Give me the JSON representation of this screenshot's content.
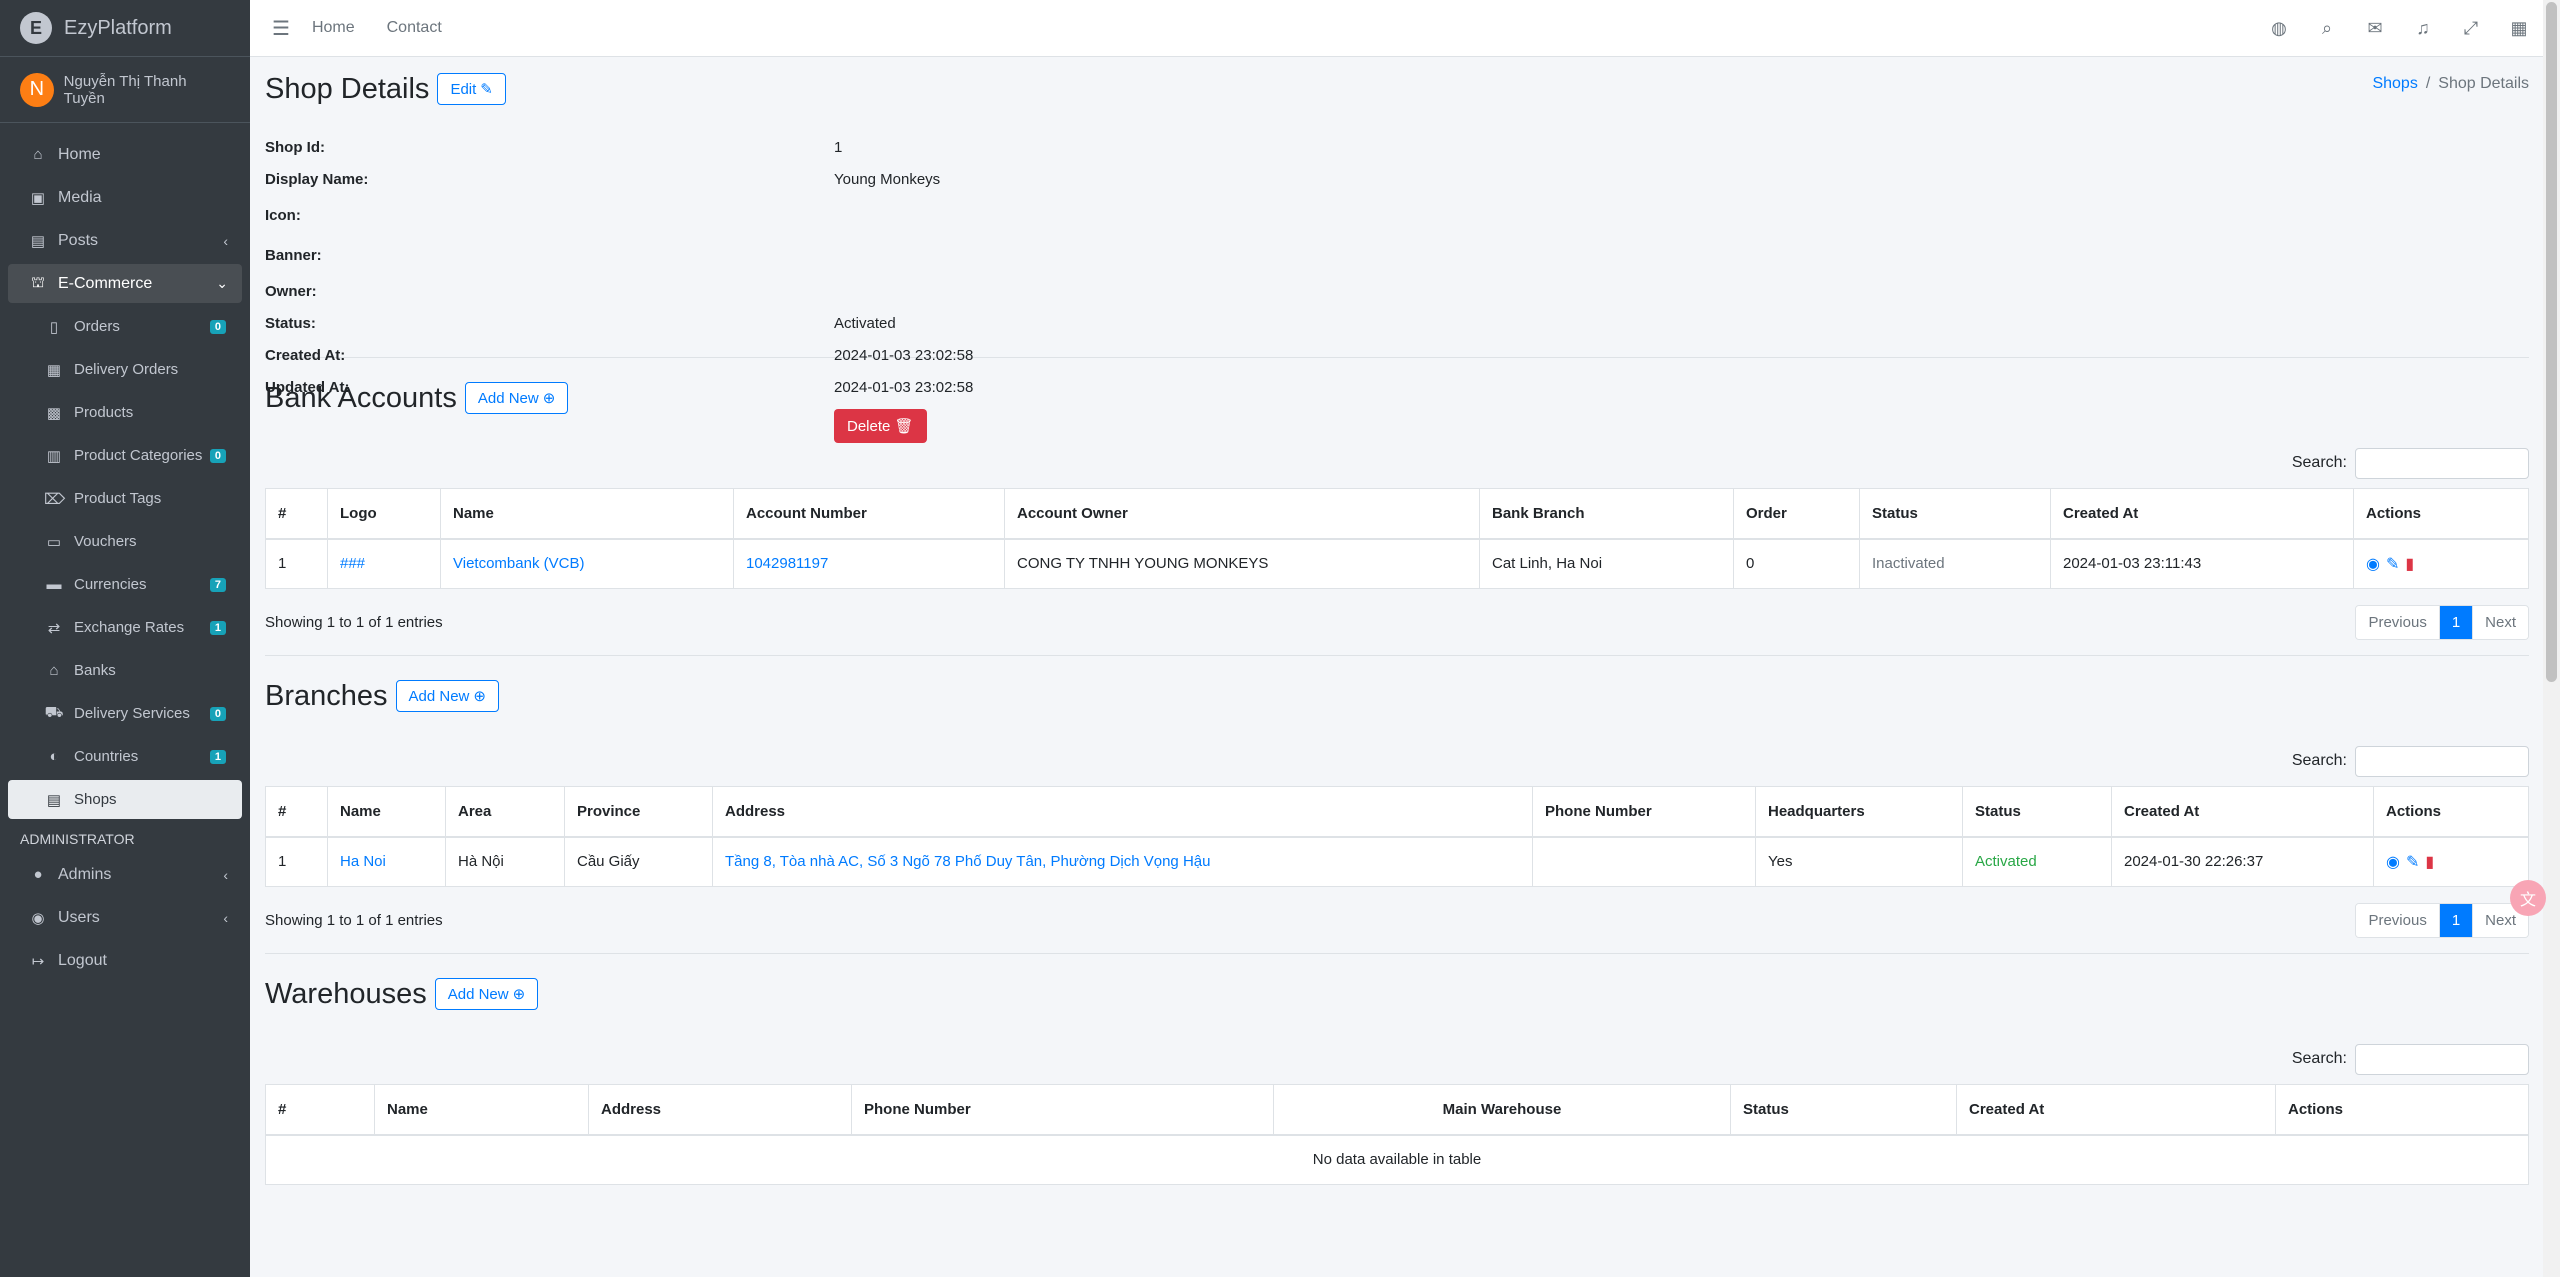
{
  "app": {
    "brand": "EzyPlatform"
  },
  "user": {
    "initial": "N",
    "name": "Nguyễn Thị Thanh Tuyền"
  },
  "sidebar": {
    "items": [
      {
        "label": "Home",
        "icon": "home-icon"
      },
      {
        "label": "Media",
        "icon": "image-icon"
      },
      {
        "label": "Posts",
        "icon": "posts-icon"
      },
      {
        "label": "E-Commerce",
        "icon": "basket-icon"
      }
    ],
    "ecommerce": [
      {
        "label": "Orders",
        "badge": "0"
      },
      {
        "label": "Delivery Orders"
      },
      {
        "label": "Products"
      },
      {
        "label": "Product Categories",
        "badge": "0"
      },
      {
        "label": "Product Tags"
      },
      {
        "label": "Vouchers"
      },
      {
        "label": "Currencies",
        "badge": "7"
      },
      {
        "label": "Exchange Rates",
        "badge": "1"
      },
      {
        "label": "Banks"
      },
      {
        "label": "Delivery Services",
        "badge": "0"
      },
      {
        "label": "Countries",
        "badge": "1"
      },
      {
        "label": "Shops"
      }
    ],
    "admin_header": "ADMINISTRATOR",
    "admin": [
      {
        "label": "Admins"
      },
      {
        "label": "Users"
      },
      {
        "label": "Logout"
      }
    ]
  },
  "topbar": {
    "home": "Home",
    "contact": "Contact"
  },
  "page": {
    "title": "Shop Details",
    "edit_label": "Edit",
    "breadcrumb": {
      "parent": "Shops",
      "current": "Shop Details"
    }
  },
  "details": {
    "shop_id_label": "Shop Id:",
    "shop_id": "1",
    "display_name_label": "Display Name:",
    "display_name": "Young Monkeys",
    "icon_label": "Icon:",
    "banner_label": "Banner:",
    "owner_label": "Owner:",
    "status_label": "Status:",
    "status": "Activated",
    "created_label": "Created At:",
    "created": "2024-01-03 23:02:58",
    "updated_label": "Updated At:",
    "updated": "2024-01-03 23:02:58",
    "delete_label": "Delete"
  },
  "common": {
    "add_new": "Add New",
    "search": "Search:",
    "previous": "Previous",
    "next": "Next",
    "page": "1"
  },
  "bank_accounts": {
    "title": "Bank Accounts",
    "headers": [
      "#",
      "Logo",
      "Name",
      "Account Number",
      "Account Owner",
      "Bank Branch",
      "Order",
      "Status",
      "Created At",
      "Actions"
    ],
    "row": {
      "num": "1",
      "logo": "###",
      "name": "Vietcombank (VCB)",
      "account_number": "1042981197",
      "owner": "CONG TY TNHH YOUNG MONKEYS",
      "branch": "Cat Linh, Ha Noi",
      "order": "0",
      "status": "Inactivated",
      "created": "2024-01-03 23:11:43"
    },
    "showing": "Showing 1 to 1 of 1 entries"
  },
  "branches": {
    "title": "Branches",
    "headers": [
      "#",
      "Name",
      "Area",
      "Province",
      "Address",
      "Phone Number",
      "Headquarters",
      "Status",
      "Created At",
      "Actions"
    ],
    "row": {
      "num": "1",
      "name": "Ha Noi",
      "area": "Hà Nội",
      "province": "Cầu Giấy",
      "address": "Tầng 8, Tòa nhà AC, Số 3 Ngõ 78 Phố Duy Tân, Phường Dịch Vọng Hậu",
      "phone": "",
      "hq": "Yes",
      "status": "Activated",
      "created": "2024-01-30 22:26:37"
    },
    "showing": "Showing 1 to 1 of 1 entries"
  },
  "warehouses": {
    "title": "Warehouses",
    "headers": [
      "#",
      "Name",
      "Address",
      "Phone Number",
      "Main Warehouse",
      "Status",
      "Created At",
      "Actions"
    ],
    "empty": "No data available in table"
  },
  "colors": {
    "primary": "#007bff",
    "danger": "#dc3545",
    "sidebar": "#343a40",
    "success": "#28a745"
  }
}
